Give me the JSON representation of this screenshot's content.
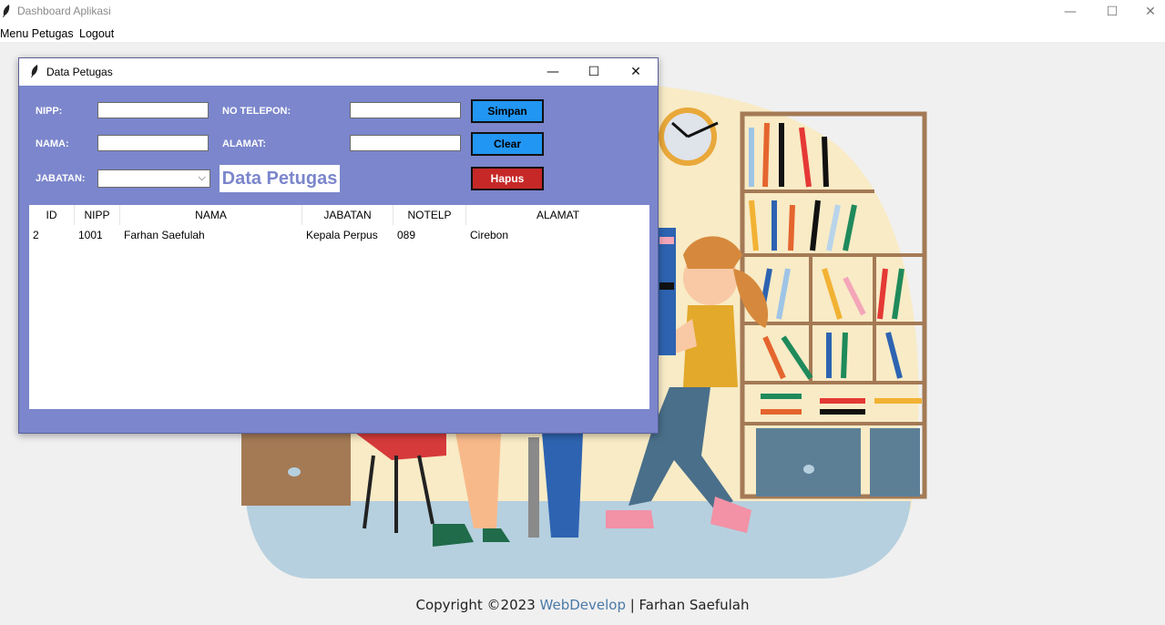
{
  "window": {
    "title": "Dashboard Aplikasi",
    "minimize": "—",
    "maximize": "☐",
    "close": "✕"
  },
  "menu": {
    "items": [
      "Menu Petugas",
      "Logout"
    ]
  },
  "footer": {
    "prefix": "Copyright ©2023 ",
    "link": "WebDevelop",
    "suffix": " | Farhan Saefulah"
  },
  "dialog": {
    "title": "Data Petugas",
    "minimize": "—",
    "maximize": "☐",
    "close": "✕",
    "heading": "Data Petugas",
    "labels": {
      "nipp": "NIPP:",
      "nama": "NAMA:",
      "jabatan": "JABATAN:",
      "telepon": "NO TELEPON:",
      "alamat": "ALAMAT:"
    },
    "fields": {
      "nipp": "",
      "nama": "",
      "jabatan": "",
      "telepon": "",
      "alamat": ""
    },
    "buttons": {
      "simpan": "Simpan",
      "clear": "Clear",
      "hapus": "Hapus"
    },
    "colors": {
      "background": "#7b86cc",
      "simpan": "#2196f3",
      "clear": "#2196f3",
      "hapus": "#c62828"
    },
    "table": {
      "columns": [
        "ID",
        "NIPP",
        "NAMA",
        "JABATAN",
        "NOTELP",
        "ALAMAT"
      ],
      "rows": [
        [
          "2",
          "1001",
          "Farhan Saefulah",
          "Kepala Perpus",
          "089",
          "Cirebon"
        ]
      ]
    }
  }
}
